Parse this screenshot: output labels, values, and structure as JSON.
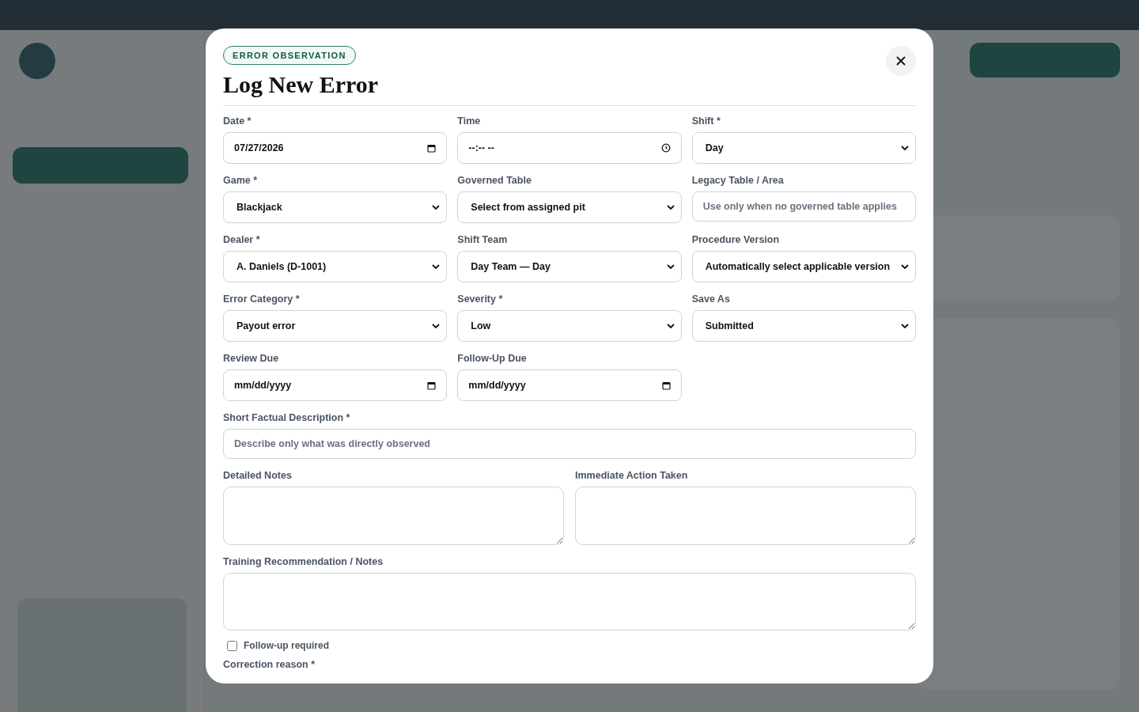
{
  "modal": {
    "badge": "ERROR OBSERVATION",
    "title": "Log New Error",
    "grid_fields": [
      {
        "label": "Date *",
        "kind": "date",
        "value": "07/27/2026"
      },
      {
        "label": "Time",
        "kind": "time",
        "value": "--:-- --"
      },
      {
        "label": "Shift *",
        "kind": "select",
        "value": "Day"
      },
      {
        "label": "Game *",
        "kind": "select",
        "value": "Blackjack"
      },
      {
        "label": "Governed Table",
        "kind": "select",
        "value": "Select from assigned pit"
      },
      {
        "label": "Legacy Table / Area",
        "kind": "text",
        "placeholder": "Use only when no governed table applies"
      },
      {
        "label": "Dealer *",
        "kind": "select",
        "value": "A. Daniels (D-1001)"
      },
      {
        "label": "Shift Team",
        "kind": "select",
        "value": "Day Team — Day"
      },
      {
        "label": "Procedure Version",
        "kind": "select",
        "value": "Automatically select applicable version"
      },
      {
        "label": "Error Category *",
        "kind": "select",
        "value": "Payout error"
      },
      {
        "label": "Severity *",
        "kind": "select",
        "value": "Low"
      },
      {
        "label": "Save As",
        "kind": "select",
        "value": "Submitted"
      },
      {
        "label": "Review Due",
        "kind": "date",
        "value": "mm/dd/yyyy"
      },
      {
        "label": "Follow-Up Due",
        "kind": "date",
        "value": "mm/dd/yyyy"
      }
    ],
    "description": {
      "label": "Short Factual Description *",
      "placeholder": "Describe only what was directly observed"
    },
    "notes": [
      {
        "label": "Detailed Notes"
      },
      {
        "label": "Immediate Action Taken"
      }
    ],
    "training": {
      "label": "Training Recommendation / Notes"
    },
    "follow_up": {
      "label": "Follow-up required",
      "checked": false
    },
    "next_label": "Correction reason *"
  }
}
